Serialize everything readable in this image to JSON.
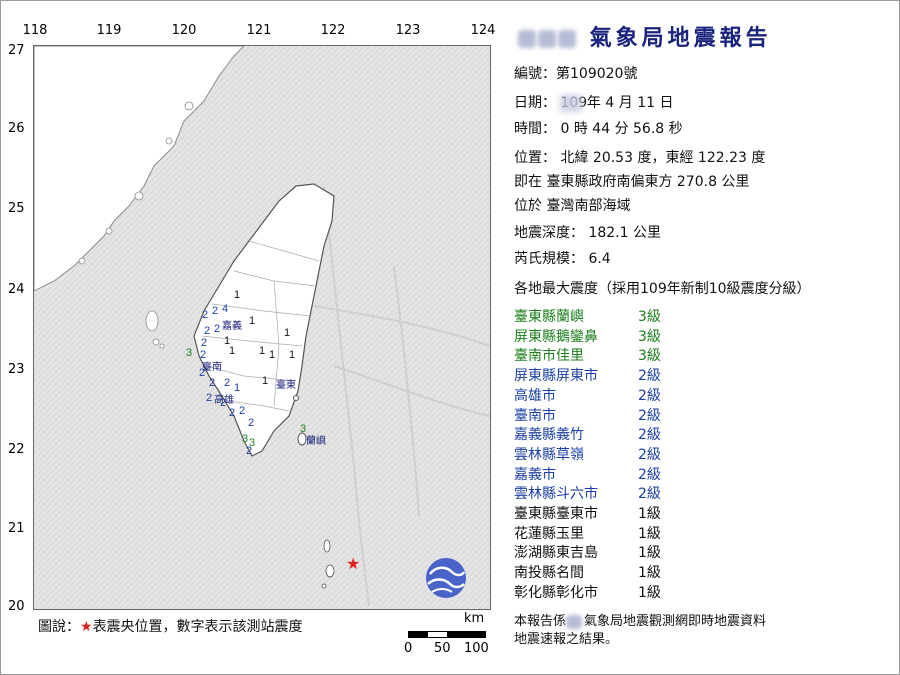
{
  "title": {
    "agency_suffix": "氣象局地震報告"
  },
  "report_number": {
    "label": "編號：",
    "value": "第109020號"
  },
  "date": {
    "label": "日期：",
    "year": "109",
    "year_unit": "年",
    "month": "4",
    "month_unit": "月",
    "day": "11",
    "day_unit": "日"
  },
  "time": {
    "label": "時間：",
    "hour": "0",
    "hour_unit": "時",
    "minute": "44",
    "minute_unit": "分",
    "second": "56.8",
    "second_unit": "秒"
  },
  "location": {
    "label": "位置：",
    "lat_prefix": "北緯",
    "lat": "20.53",
    "lat_unit": "度，",
    "lon_prefix": "東經",
    "lon": "122.23",
    "lon_unit": "度",
    "relative": "即在 臺東縣政府南偏東方 270.8 公里",
    "region": "位於 臺灣南部海域"
  },
  "depth": {
    "label": "地震深度：",
    "value": "182.1",
    "unit": "公里"
  },
  "magnitude": {
    "label": "芮氏規模：",
    "value": "6.4"
  },
  "intensity_header": "各地最大震度（採用109年新制10級震度分級）",
  "intensities": [
    {
      "site": "臺東縣蘭嶼",
      "level": "3級",
      "level_num": 3
    },
    {
      "site": "屏東縣鵝鑾鼻",
      "level": "3級",
      "level_num": 3
    },
    {
      "site": "臺南市佳里",
      "level": "3級",
      "level_num": 3
    },
    {
      "site": "屏東縣屏東市",
      "level": "2級",
      "level_num": 2
    },
    {
      "site": "高雄市",
      "level": "2級",
      "level_num": 2
    },
    {
      "site": "臺南市",
      "level": "2級",
      "level_num": 2
    },
    {
      "site": "嘉義縣義竹",
      "level": "2級",
      "level_num": 2
    },
    {
      "site": "雲林縣草嶺",
      "level": "2級",
      "level_num": 2
    },
    {
      "site": "嘉義市",
      "level": "2級",
      "level_num": 2
    },
    {
      "site": "雲林縣斗六市",
      "level": "2級",
      "level_num": 2
    },
    {
      "site": "臺東縣臺東市",
      "level": "1級",
      "level_num": 1
    },
    {
      "site": "花蓮縣玉里",
      "level": "1級",
      "level_num": 1
    },
    {
      "site": "澎湖縣東吉島",
      "level": "1級",
      "level_num": 1
    },
    {
      "site": "南投縣名間",
      "level": "1級",
      "level_num": 1
    },
    {
      "site": "彰化縣彰化市",
      "level": "1級",
      "level_num": 1
    }
  ],
  "footnote": {
    "line1_a": "本報告係",
    "line1_b": "氣象局地震觀測網即時地震資料",
    "line2": "地震速報之結果。"
  },
  "legend": {
    "prefix": "圖說：",
    "star": "★",
    "text": "表震央位置，數字表示該測站震度"
  },
  "scale": {
    "unit": "km",
    "labels": [
      "0",
      "50",
      "100"
    ]
  },
  "map": {
    "lon_ticks": [
      "118",
      "119",
      "120",
      "121",
      "122",
      "123",
      "124"
    ],
    "lat_ticks": [
      "27",
      "26",
      "25",
      "24",
      "23",
      "22",
      "21",
      "20"
    ],
    "place_labels": [
      "嘉義",
      "臺南",
      "高雄",
      "臺東",
      "蘭嶼"
    ],
    "epicenter": {
      "lat": 20.53,
      "lon": 122.23
    },
    "colors": {
      "sea": "#e6e6e6",
      "land": "#ffffff",
      "epicenter": "#e02020",
      "level2": "#1a3fa6",
      "level3": "#1b7f1b",
      "title": "#1a237e"
    }
  }
}
